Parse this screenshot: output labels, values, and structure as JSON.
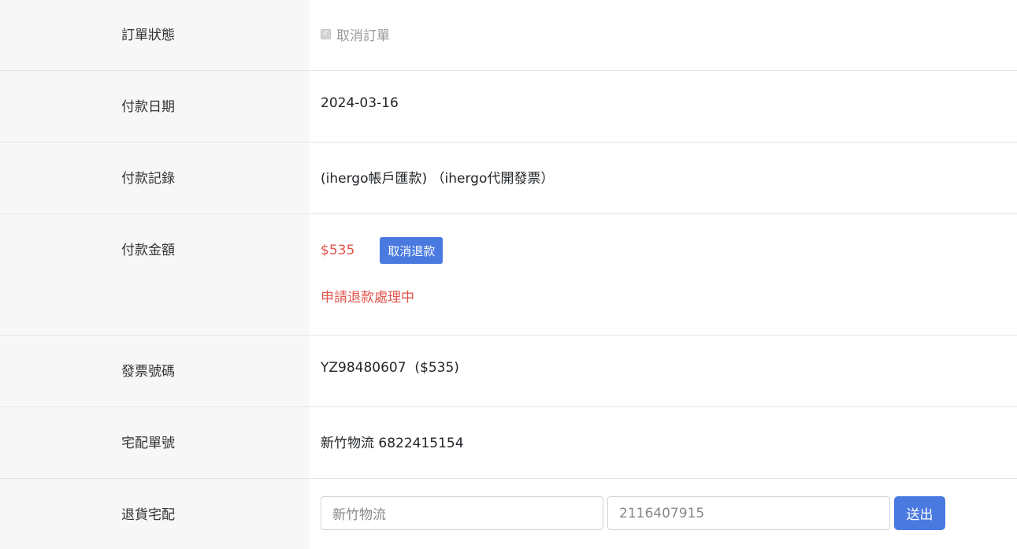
{
  "order_status": {
    "label": "訂單狀態",
    "checkbox_label": "取消訂單",
    "checked": true,
    "disabled": true
  },
  "payment_date": {
    "label": "付款日期",
    "value": "2024-03-16"
  },
  "payment_record": {
    "label": "付款記錄",
    "value": "(ihergo帳戶匯款) （ihergo代開發票）"
  },
  "payment_amount": {
    "label": "付款金額",
    "amount": "$535",
    "cancel_refund_button": "取消退款",
    "refund_status": "申請退款處理中"
  },
  "invoice_number": {
    "label": "發票號碼",
    "value": "YZ98480607  ($535)"
  },
  "tracking_number": {
    "label": "宅配單號",
    "value": "新竹物流 6822415154"
  },
  "return_delivery": {
    "label": "退貨宅配",
    "carrier_value": "新竹物流",
    "number_value": "2116407915",
    "submit_button": "送出"
  },
  "colors": {
    "accent": "#4a7ae0",
    "alert": "#e0544c",
    "label_bg": "#f7f7f7"
  }
}
